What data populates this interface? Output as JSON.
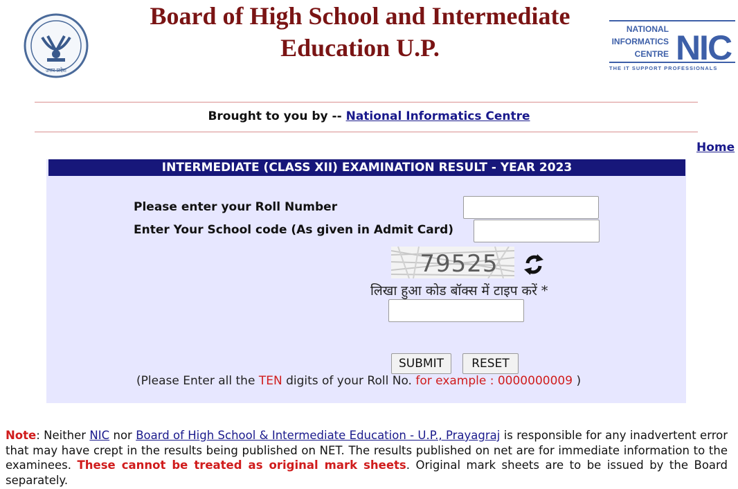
{
  "header": {
    "title_line1": "Board of High School and Intermediate",
    "title_line2": "Education U.P.",
    "seal_text": "उत्तर प्रदेश",
    "nic_logo": {
      "line1": "NATIONAL",
      "line2": "INFORMATICS",
      "line3": "CENTRE",
      "mark": "NIC",
      "tagline": "THE IT SUPPORT PROFESSIONALS"
    }
  },
  "brought_by": {
    "prefix": "Brought to you by --",
    "link": "National Informatics Centre"
  },
  "home_link": "Home",
  "form": {
    "title": "INTERMEDIATE (CLASS XII)  EXAMINATION RESULT - YEAR 2023",
    "roll_label": "Please enter your Roll Number",
    "roll_value": "",
    "school_label": "Enter Your School code (As given in Admit Card)",
    "school_value": "",
    "captcha_text": "79525",
    "captcha_prompt": "लिखा हुआ कोड बॉक्स में टाइप करें *",
    "captcha_value": "",
    "submit_label": "SUBMIT",
    "reset_label": "RESET",
    "hint_open": "(Please Enter all the",
    "hint_ten": "TEN",
    "hint_mid": "digits of your Roll No.",
    "hint_example": "for example : 0000000009",
    "hint_close": ")"
  },
  "note": {
    "label": "Note",
    "text1": ": Neither",
    "nic_link": "NIC",
    "text2": "nor",
    "board_link": "Board of High School & Intermediate Education - U.P., Prayagraj",
    "text3": "is responsible for any inadvertent error that may have crept in the results being published on NET. The results published on net are for immediate information to the examinees.",
    "warning": "These cannot be treated as original mark sheets",
    "text4": ". Original mark sheets are to be issued by the Board separately."
  },
  "colors": {
    "title": "#7a1414",
    "panel_header": "#17177a",
    "panel_bg": "#e7e7ff",
    "link": "#1a1a8c",
    "alert_red": "#d01c1c",
    "rule": "#d9908f"
  }
}
